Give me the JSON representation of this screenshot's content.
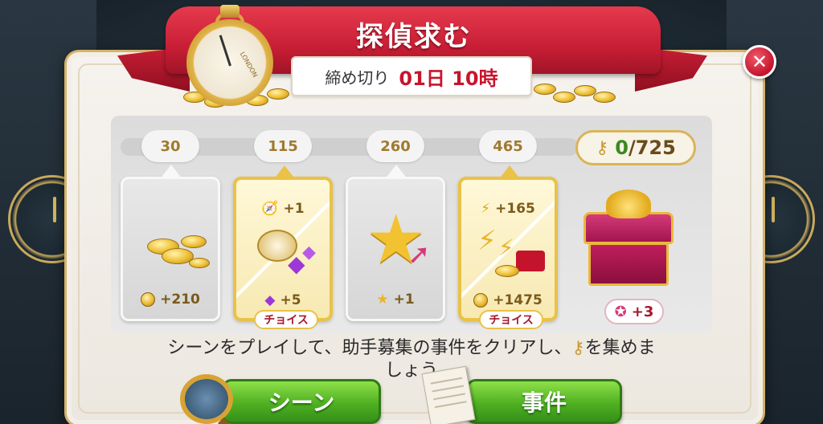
{
  "header": {
    "title": "探偵求む",
    "deadline_label": "締め切り",
    "deadline_value": "01日 10時",
    "stopwatch_brand": "LONDON"
  },
  "progress": {
    "milestones": [
      "30",
      "115",
      "260",
      "465"
    ],
    "current": "0",
    "total": "/725",
    "icon": "key-icon"
  },
  "rewards": [
    {
      "type": "coins",
      "label": "+210",
      "icon": "coin-icon"
    },
    {
      "type": "choice",
      "top_label": "+1",
      "top_icon": "compass-icon",
      "bottom_label": "+5",
      "bottom_icon": "gem-icon",
      "choice_label": "チョイス"
    },
    {
      "type": "star",
      "label": "+1",
      "icon": "star-icon"
    },
    {
      "type": "choice",
      "top_label": "+165",
      "top_icon": "bolt-icon",
      "bottom_label": "+1475",
      "bottom_icon": "coin-icon",
      "choice_label": "チョイス"
    }
  ],
  "chest": {
    "bonus_label": "+3",
    "icon": "chest-icon"
  },
  "instruction": {
    "line1_before": "シーンをプレイして、助手募集の事件をクリアし、",
    "line1_after": "を集めま",
    "line2": "しょう"
  },
  "buttons": {
    "scene_label": "シーン",
    "case_label": "事件",
    "close_icon": "close-icon"
  },
  "colors": {
    "ribbon": "#c81e35",
    "accent_gold": "#e9c247",
    "button_green": "#4fb021",
    "counter_green": "#3a8a1e",
    "deadline_red": "#c8142d"
  }
}
